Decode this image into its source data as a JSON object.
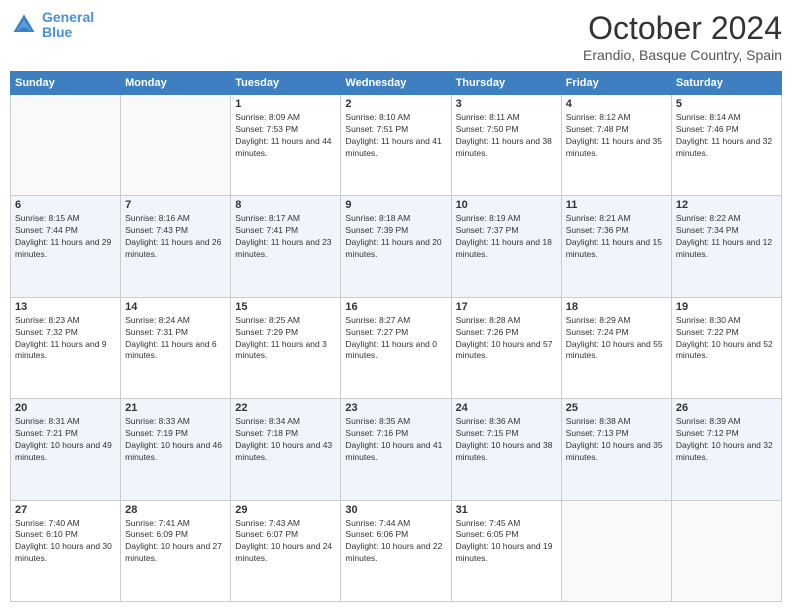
{
  "header": {
    "logo_line1": "General",
    "logo_line2": "Blue",
    "month": "October 2024",
    "location": "Erandio, Basque Country, Spain"
  },
  "weekdays": [
    "Sunday",
    "Monday",
    "Tuesday",
    "Wednesday",
    "Thursday",
    "Friday",
    "Saturday"
  ],
  "weeks": [
    [
      {
        "day": "",
        "info": ""
      },
      {
        "day": "",
        "info": ""
      },
      {
        "day": "1",
        "info": "Sunrise: 8:09 AM\nSunset: 7:53 PM\nDaylight: 11 hours and 44 minutes."
      },
      {
        "day": "2",
        "info": "Sunrise: 8:10 AM\nSunset: 7:51 PM\nDaylight: 11 hours and 41 minutes."
      },
      {
        "day": "3",
        "info": "Sunrise: 8:11 AM\nSunset: 7:50 PM\nDaylight: 11 hours and 38 minutes."
      },
      {
        "day": "4",
        "info": "Sunrise: 8:12 AM\nSunset: 7:48 PM\nDaylight: 11 hours and 35 minutes."
      },
      {
        "day": "5",
        "info": "Sunrise: 8:14 AM\nSunset: 7:46 PM\nDaylight: 11 hours and 32 minutes."
      }
    ],
    [
      {
        "day": "6",
        "info": "Sunrise: 8:15 AM\nSunset: 7:44 PM\nDaylight: 11 hours and 29 minutes."
      },
      {
        "day": "7",
        "info": "Sunrise: 8:16 AM\nSunset: 7:43 PM\nDaylight: 11 hours and 26 minutes."
      },
      {
        "day": "8",
        "info": "Sunrise: 8:17 AM\nSunset: 7:41 PM\nDaylight: 11 hours and 23 minutes."
      },
      {
        "day": "9",
        "info": "Sunrise: 8:18 AM\nSunset: 7:39 PM\nDaylight: 11 hours and 20 minutes."
      },
      {
        "day": "10",
        "info": "Sunrise: 8:19 AM\nSunset: 7:37 PM\nDaylight: 11 hours and 18 minutes."
      },
      {
        "day": "11",
        "info": "Sunrise: 8:21 AM\nSunset: 7:36 PM\nDaylight: 11 hours and 15 minutes."
      },
      {
        "day": "12",
        "info": "Sunrise: 8:22 AM\nSunset: 7:34 PM\nDaylight: 11 hours and 12 minutes."
      }
    ],
    [
      {
        "day": "13",
        "info": "Sunrise: 8:23 AM\nSunset: 7:32 PM\nDaylight: 11 hours and 9 minutes."
      },
      {
        "day": "14",
        "info": "Sunrise: 8:24 AM\nSunset: 7:31 PM\nDaylight: 11 hours and 6 minutes."
      },
      {
        "day": "15",
        "info": "Sunrise: 8:25 AM\nSunset: 7:29 PM\nDaylight: 11 hours and 3 minutes."
      },
      {
        "day": "16",
        "info": "Sunrise: 8:27 AM\nSunset: 7:27 PM\nDaylight: 11 hours and 0 minutes."
      },
      {
        "day": "17",
        "info": "Sunrise: 8:28 AM\nSunset: 7:26 PM\nDaylight: 10 hours and 57 minutes."
      },
      {
        "day": "18",
        "info": "Sunrise: 8:29 AM\nSunset: 7:24 PM\nDaylight: 10 hours and 55 minutes."
      },
      {
        "day": "19",
        "info": "Sunrise: 8:30 AM\nSunset: 7:22 PM\nDaylight: 10 hours and 52 minutes."
      }
    ],
    [
      {
        "day": "20",
        "info": "Sunrise: 8:31 AM\nSunset: 7:21 PM\nDaylight: 10 hours and 49 minutes."
      },
      {
        "day": "21",
        "info": "Sunrise: 8:33 AM\nSunset: 7:19 PM\nDaylight: 10 hours and 46 minutes."
      },
      {
        "day": "22",
        "info": "Sunrise: 8:34 AM\nSunset: 7:18 PM\nDaylight: 10 hours and 43 minutes."
      },
      {
        "day": "23",
        "info": "Sunrise: 8:35 AM\nSunset: 7:16 PM\nDaylight: 10 hours and 41 minutes."
      },
      {
        "day": "24",
        "info": "Sunrise: 8:36 AM\nSunset: 7:15 PM\nDaylight: 10 hours and 38 minutes."
      },
      {
        "day": "25",
        "info": "Sunrise: 8:38 AM\nSunset: 7:13 PM\nDaylight: 10 hours and 35 minutes."
      },
      {
        "day": "26",
        "info": "Sunrise: 8:39 AM\nSunset: 7:12 PM\nDaylight: 10 hours and 32 minutes."
      }
    ],
    [
      {
        "day": "27",
        "info": "Sunrise: 7:40 AM\nSunset: 6:10 PM\nDaylight: 10 hours and 30 minutes."
      },
      {
        "day": "28",
        "info": "Sunrise: 7:41 AM\nSunset: 6:09 PM\nDaylight: 10 hours and 27 minutes."
      },
      {
        "day": "29",
        "info": "Sunrise: 7:43 AM\nSunset: 6:07 PM\nDaylight: 10 hours and 24 minutes."
      },
      {
        "day": "30",
        "info": "Sunrise: 7:44 AM\nSunset: 6:06 PM\nDaylight: 10 hours and 22 minutes."
      },
      {
        "day": "31",
        "info": "Sunrise: 7:45 AM\nSunset: 6:05 PM\nDaylight: 10 hours and 19 minutes."
      },
      {
        "day": "",
        "info": ""
      },
      {
        "day": "",
        "info": ""
      }
    ]
  ]
}
